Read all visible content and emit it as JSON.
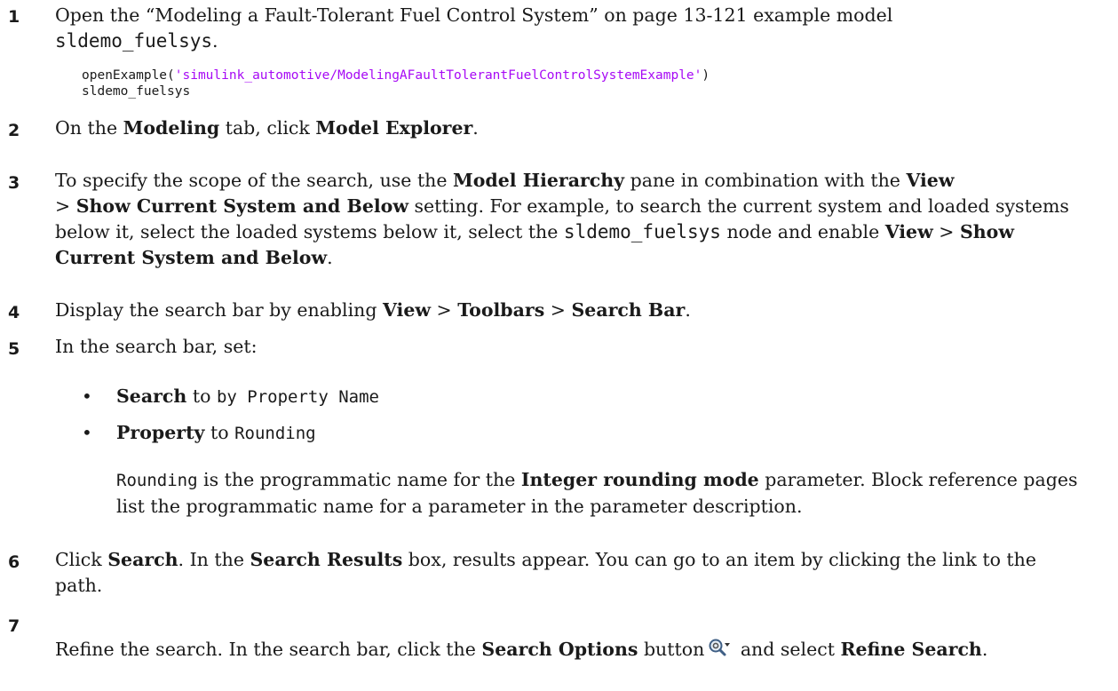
{
  "steps": [
    {
      "num": "1",
      "lead": "Open the “Modeling a Fault-Tolerant Fuel Control System” on page 13-121 example model",
      "model": "sldemo_fuelsys",
      "end": ".",
      "code_fn": "openExample(",
      "code_str": "'simulink_automotive/ModelingAFaultTolerantFuelControlSystemExample'",
      "code_close": ")",
      "code_line2": "sldemo_fuelsys"
    },
    {
      "num": "2",
      "t1": "On the ",
      "b1": "Modeling",
      "t2": " tab, click ",
      "b2": "Model Explorer",
      "t3": "."
    },
    {
      "num": "3",
      "t1": "To specify the scope of the search, use the ",
      "b1": "Model Hierarchy",
      "t2": " pane in combination with the ",
      "b2": "View",
      "t3": " > ",
      "b3": "Show Current System and Below",
      "t4": " setting. For example, to search the current system and loaded systems below it, select the ",
      "m1": "sldemo_fuelsys",
      "t5": " node and enable ",
      "b4": "View",
      "t6": " > ",
      "b5": "Show Current System and Below",
      "t7": "."
    },
    {
      "num": "4",
      "t1": "Display the search bar by enabling ",
      "b1": "View",
      "t2": " > ",
      "b2": "Toolbars",
      "t3": " > ",
      "b3": "Search Bar",
      "t4": "."
    },
    {
      "num": "5",
      "t1": "In the search bar, set:",
      "bullets": [
        {
          "bold": "Search",
          "to": " to ",
          "val": "by Property Name"
        },
        {
          "bold": "Property",
          "to": " to ",
          "val": "Rounding"
        }
      ],
      "note_m": "Rounding",
      "note_t1": " is the programmatic name for the ",
      "note_b": "Integer rounding mode",
      "note_t2": " parameter. Block reference pages list the programmatic name for a parameter in the parameter description."
    },
    {
      "num": "6",
      "t1": "Click ",
      "b1": "Search",
      "t2": ". In the ",
      "b2": "Search Results",
      "t3": " box, results appear. You can go to an item by clicking the link to the path."
    },
    {
      "num": "7",
      "t1": "Refine the search. In the search bar, click the ",
      "b1": "Search Options",
      "t2": " button",
      "icon": "search-options-icon",
      "t3": " and select ",
      "b2": "Refine Search",
      "t4": "."
    }
  ]
}
